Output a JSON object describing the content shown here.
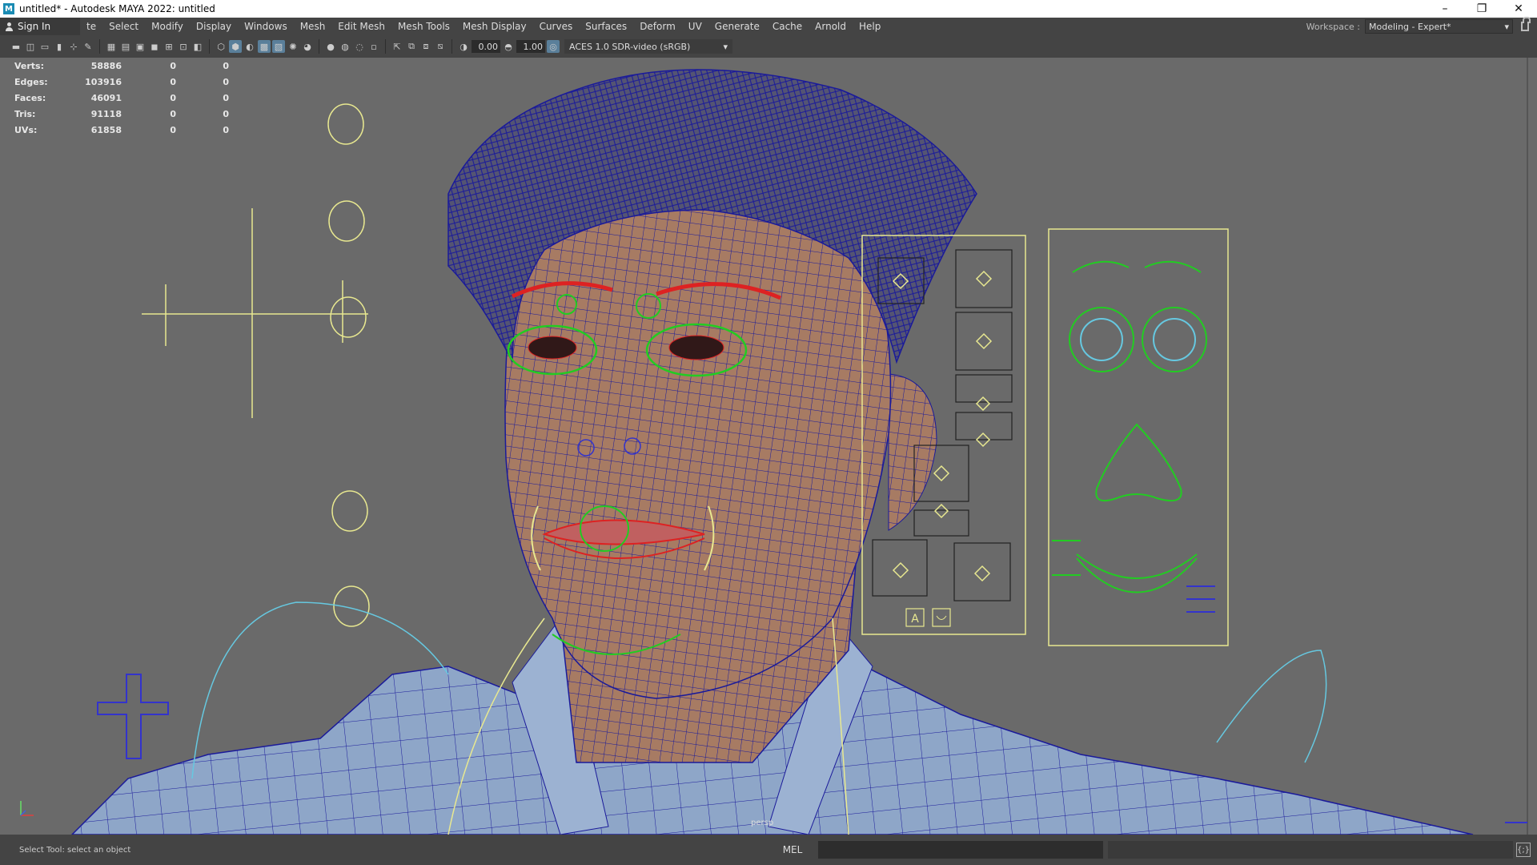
{
  "window": {
    "title": "untitled* - Autodesk MAYA 2022: untitled",
    "minimize": "–",
    "restore": "❐",
    "close": "✕"
  },
  "menubar": {
    "sign_in": "Sign In",
    "items": [
      "te",
      "Select",
      "Modify",
      "Display",
      "Windows",
      "Mesh",
      "Edit Mesh",
      "Mesh Tools",
      "Mesh Display",
      "Curves",
      "Surfaces",
      "Deform",
      "UV",
      "Generate",
      "Cache",
      "Arnold",
      "Help"
    ],
    "workspace_label": "Workspace :",
    "workspace_value": "Modeling - Expert*"
  },
  "toolbar": {
    "exposure": "0.00",
    "gamma": "1.00",
    "color_space": "ACES 1.0 SDR-video (sRGB)"
  },
  "hud": {
    "rows": [
      {
        "label": "Verts:",
        "v1": "58886",
        "v2": "0",
        "v3": "0"
      },
      {
        "label": "Edges:",
        "v1": "103916",
        "v2": "0",
        "v3": "0"
      },
      {
        "label": "Faces:",
        "v1": "46091",
        "v2": "0",
        "v3": "0"
      },
      {
        "label": "Tris:",
        "v1": "91118",
        "v2": "0",
        "v3": "0"
      },
      {
        "label": "UVs:",
        "v1": "61858",
        "v2": "0",
        "v3": "0"
      }
    ]
  },
  "viewport": {
    "camera": "persp",
    "colors": {
      "background": "#6a6a6a",
      "wire": "#1a1a9a",
      "rig_yellow": "#e8e890",
      "rig_green": "#22cc22",
      "rig_cyan": "#66c8e0",
      "rig_red": "#dd2222",
      "skin": "#b0826a",
      "shirt": "#8aa4c8",
      "hair": "#3a3a58"
    },
    "panel_letter": "A"
  },
  "status": {
    "help_line": "Select Tool: select an object",
    "mel_label": "MEL"
  }
}
